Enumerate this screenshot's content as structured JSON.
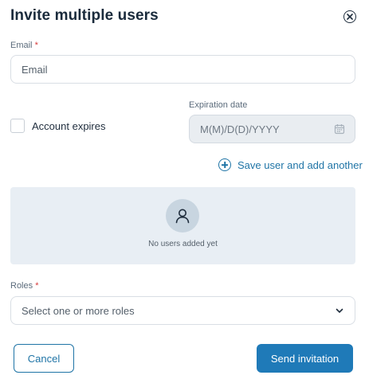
{
  "dialog": {
    "title": "Invite multiple users",
    "close_icon": "close-circle-icon"
  },
  "email": {
    "label": "Email",
    "required_mark": "*",
    "placeholder": "Email"
  },
  "account_expires": {
    "label": "Account expires",
    "checked": false
  },
  "expiration": {
    "label": "Expiration date",
    "placeholder": "M(M)/D(D)/YYYY",
    "icon": "calendar-icon"
  },
  "add_another": {
    "label": "Save user and add another",
    "icon": "plus-circle-icon"
  },
  "users_panel": {
    "empty_text": "No users added yet",
    "icon": "user-icon"
  },
  "roles": {
    "label": "Roles",
    "required_mark": "*",
    "placeholder": "Select one or more roles",
    "icon": "chevron-down-icon"
  },
  "footer": {
    "cancel_label": "Cancel",
    "send_label": "Send invitation"
  },
  "colors": {
    "accent": "#1f74a6",
    "primary_button": "#1f7ab8",
    "required": "#d63a3a",
    "panel_bg": "#e8eef4"
  }
}
